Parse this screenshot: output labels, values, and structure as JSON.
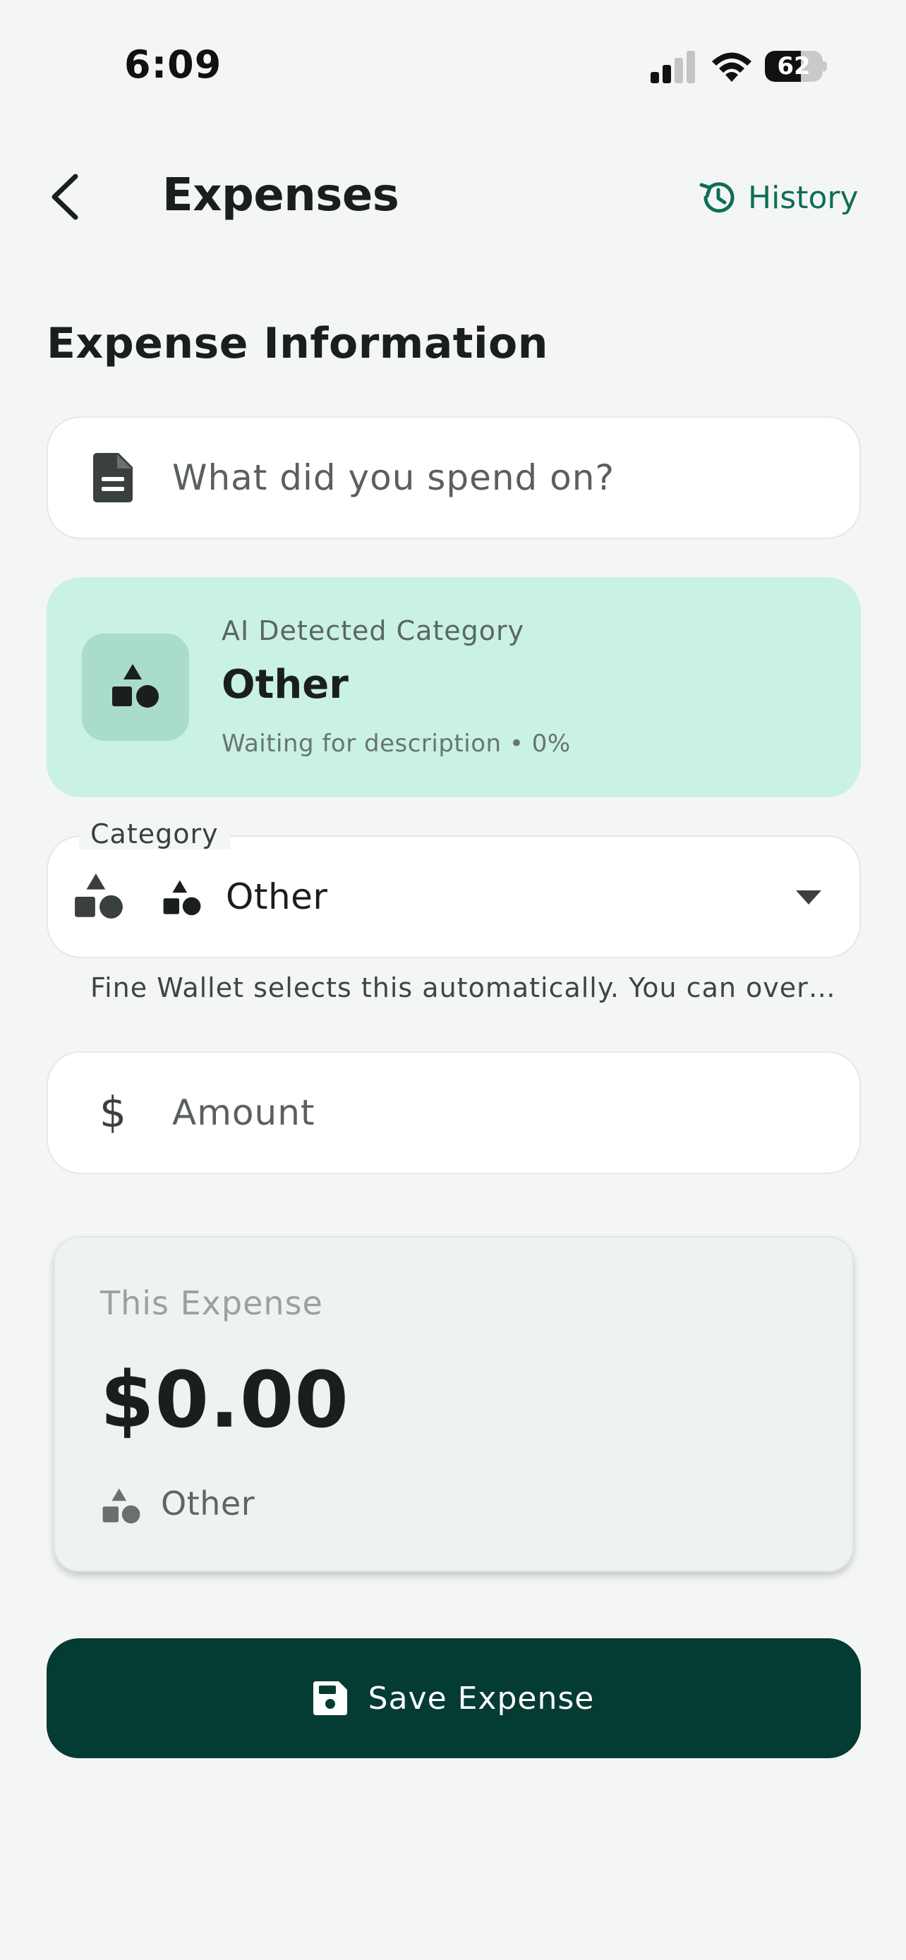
{
  "status_bar": {
    "time": "6:09",
    "battery_level": "62",
    "battery_fraction": 0.62,
    "icons": [
      "cellular-signal-icon",
      "wifi-icon",
      "battery-icon"
    ]
  },
  "header": {
    "back_icon": "chevron-left-icon",
    "title": "Expenses",
    "history_label": "History",
    "history_icon": "history-clock-icon"
  },
  "section_title": "Expense Information",
  "description_field": {
    "icon": "document-icon",
    "placeholder": "What did you spend on?",
    "value": ""
  },
  "ai_detection": {
    "icon": "category-shapes-icon",
    "label": "AI Detected Category",
    "category": "Other",
    "status": "Waiting for description • 0%"
  },
  "category_field": {
    "label": "Category",
    "leading_icon": "category-shapes-icon",
    "selected_icon": "category-shapes-icon",
    "selected_value": "Other",
    "dropdown_icon": "caret-down-icon",
    "helper_text": "Fine Wallet selects this automatically. You can over…"
  },
  "amount_field": {
    "icon": "dollar-icon",
    "icon_glyph": "$",
    "placeholder": "Amount",
    "value": ""
  },
  "summary": {
    "label": "This Expense",
    "amount": "$0.00",
    "category_icon": "category-shapes-icon",
    "category": "Other"
  },
  "save_button": {
    "icon": "save-floppy-icon",
    "label": "Save Expense"
  },
  "colors": {
    "background": "#f4f6f5",
    "accent": "#0f6e55",
    "ai_card": "#c9f2e3",
    "primary_button": "#043b32",
    "text": "#1a1f1d"
  }
}
